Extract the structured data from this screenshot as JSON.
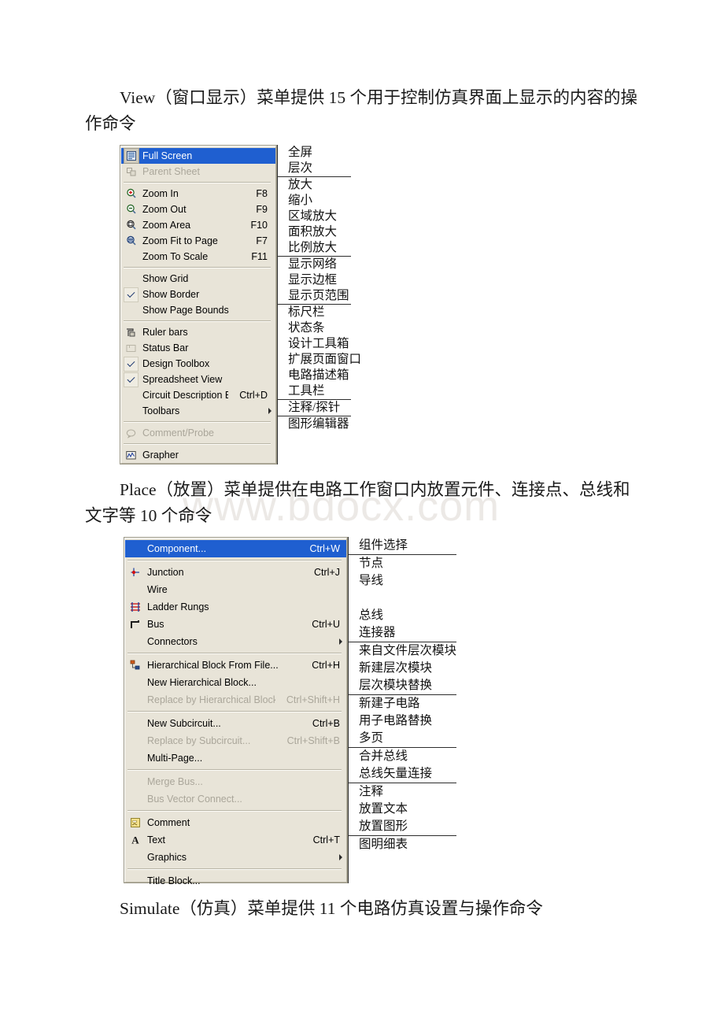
{
  "paragraphs": {
    "view_intro": "View（窗口显示）菜单提供 15 个用于控制仿真界面上显示的内容的操作命令",
    "place_intro": "Place（放置）菜单提供在电路工作窗口内放置元件、连接点、总线和文字等 10 个命令",
    "simulate_intro": "Simulate（仿真）菜单提供 11 个电路仿真设置与操作命令"
  },
  "watermark": "www.bdocx.com",
  "colors": {
    "menu_background": "#e8e4d8",
    "menu_border": "#9a9684",
    "highlight": "#1f5fd0",
    "highlight_text": "#ffffff",
    "disabled_text": "#aaa69a",
    "separator": "#b9b5a6"
  },
  "view_menu": {
    "name": "View",
    "items": [
      {
        "label": "Full Screen",
        "accel": "",
        "icon": "full-screen-icon",
        "state": "selected",
        "checked": false,
        "submenu": false
      },
      {
        "label": "Parent Sheet",
        "accel": "",
        "icon": "parent-sheet-icon",
        "state": "disabled",
        "checked": false,
        "submenu": false
      },
      {
        "separator": true
      },
      {
        "label": "Zoom In",
        "accel": "F8",
        "icon": "zoom-in-icon",
        "state": "normal",
        "checked": false,
        "submenu": false
      },
      {
        "label": "Zoom Out",
        "accel": "F9",
        "icon": "zoom-out-icon",
        "state": "normal",
        "checked": false,
        "submenu": false
      },
      {
        "label": "Zoom Area",
        "accel": "F10",
        "icon": "zoom-area-icon",
        "state": "normal",
        "checked": false,
        "submenu": false
      },
      {
        "label": "Zoom Fit to Page",
        "accel": "F7",
        "icon": "zoom-fit-page-icon",
        "state": "normal",
        "checked": false,
        "submenu": false
      },
      {
        "label": "Zoom To Scale",
        "accel": "F11",
        "icon": "",
        "state": "normal",
        "checked": false,
        "submenu": false
      },
      {
        "separator": true
      },
      {
        "label": "Show Grid",
        "accel": "",
        "icon": "",
        "state": "normal",
        "checked": false,
        "submenu": false
      },
      {
        "label": "Show Border",
        "accel": "",
        "icon": "",
        "state": "normal",
        "checked": true,
        "submenu": false
      },
      {
        "label": "Show Page Bounds",
        "accel": "",
        "icon": "",
        "state": "normal",
        "checked": false,
        "submenu": false
      },
      {
        "separator": true
      },
      {
        "label": "Ruler bars",
        "accel": "",
        "icon": "ruler-bars-icon",
        "state": "normal",
        "checked": false,
        "submenu": false
      },
      {
        "label": "Status Bar",
        "accel": "",
        "icon": "status-bar-icon",
        "state": "normal",
        "checked": false,
        "submenu": false
      },
      {
        "label": "Design Toolbox",
        "accel": "",
        "icon": "",
        "state": "normal",
        "checked": true,
        "submenu": false
      },
      {
        "label": "Spreadsheet View",
        "accel": "",
        "icon": "",
        "state": "normal",
        "checked": true,
        "submenu": false
      },
      {
        "label": "Circuit Description Box",
        "accel": "Ctrl+D",
        "icon": "",
        "state": "normal",
        "checked": false,
        "submenu": false
      },
      {
        "label": "Toolbars",
        "accel": "",
        "icon": "",
        "state": "normal",
        "checked": false,
        "submenu": true
      },
      {
        "separator": true
      },
      {
        "label": "Comment/Probe",
        "accel": "",
        "icon": "comment-probe-icon",
        "state": "disabled",
        "checked": false,
        "submenu": false
      },
      {
        "separator": true
      },
      {
        "label": "Grapher",
        "accel": "",
        "icon": "grapher-icon",
        "state": "normal",
        "checked": false,
        "submenu": false
      }
    ],
    "translations": [
      {
        "rows": [
          "全屏",
          "层次"
        ]
      },
      {
        "rows": [
          "放大",
          "缩小",
          "区域放大",
          "面积放大",
          "比例放大"
        ]
      },
      {
        "rows": [
          "显示网络",
          "显示边框",
          "显示页范围"
        ]
      },
      {
        "rows": [
          "标尺栏",
          "状态条",
          "设计工具箱",
          "扩展页面窗口",
          "电路描述箱",
          "工具栏"
        ]
      },
      {
        "rows": [
          "注释/探针"
        ]
      },
      {
        "rows": [
          "图形编辑器"
        ]
      }
    ]
  },
  "place_menu": {
    "name": "Place",
    "items": [
      {
        "label": "Component...",
        "accel": "Ctrl+W",
        "icon": "",
        "state": "selected",
        "submenu": false
      },
      {
        "separator": true
      },
      {
        "label": "Junction",
        "accel": "Ctrl+J",
        "icon": "junction-icon",
        "state": "normal",
        "submenu": false
      },
      {
        "label": "Wire",
        "accel": "",
        "icon": "",
        "state": "normal",
        "submenu": false
      },
      {
        "label": "Ladder Rungs",
        "accel": "",
        "icon": "ladder-rungs-icon",
        "state": "normal",
        "submenu": false
      },
      {
        "label": "Bus",
        "accel": "Ctrl+U",
        "icon": "bus-icon",
        "state": "normal",
        "submenu": false
      },
      {
        "label": "Connectors",
        "accel": "",
        "icon": "",
        "state": "normal",
        "submenu": true
      },
      {
        "separator": true
      },
      {
        "label": "Hierarchical Block From File...",
        "accel": "Ctrl+H",
        "icon": "hierarchical-block-icon",
        "state": "normal",
        "submenu": false
      },
      {
        "label": "New Hierarchical Block...",
        "accel": "",
        "icon": "",
        "state": "normal",
        "submenu": false
      },
      {
        "label": "Replace by Hierarchical Block...",
        "accel": "Ctrl+Shift+H",
        "icon": "",
        "state": "disabled",
        "submenu": false
      },
      {
        "separator": true
      },
      {
        "label": "New Subcircuit...",
        "accel": "Ctrl+B",
        "icon": "",
        "state": "normal",
        "submenu": false
      },
      {
        "label": "Replace by Subcircuit...",
        "accel": "Ctrl+Shift+B",
        "icon": "",
        "state": "disabled",
        "submenu": false
      },
      {
        "label": "Multi-Page...",
        "accel": "",
        "icon": "",
        "state": "normal",
        "submenu": false
      },
      {
        "separator": true
      },
      {
        "label": "Merge Bus...",
        "accel": "",
        "icon": "",
        "state": "disabled",
        "submenu": false
      },
      {
        "label": "Bus Vector Connect...",
        "accel": "",
        "icon": "",
        "state": "disabled",
        "submenu": false
      },
      {
        "separator": true
      },
      {
        "label": "Comment",
        "accel": "",
        "icon": "comment-icon",
        "state": "normal",
        "submenu": false
      },
      {
        "label": "Text",
        "accel": "Ctrl+T",
        "icon": "text-icon",
        "state": "normal",
        "submenu": false
      },
      {
        "label": "Graphics",
        "accel": "",
        "icon": "",
        "state": "normal",
        "submenu": true
      },
      {
        "separator": true
      },
      {
        "label": "Title Block...",
        "accel": "",
        "icon": "",
        "state": "normal",
        "submenu": false
      }
    ],
    "translations": [
      {
        "rows": [
          "组件选择"
        ]
      },
      {
        "rows": [
          "节点",
          "导线",
          "",
          "总线",
          "连接器"
        ]
      },
      {
        "rows": [
          "来自文件层次模块",
          "新建层次模块",
          "层次模块替换"
        ]
      },
      {
        "rows": [
          "新建子电路",
          "用子电路替换",
          "多页"
        ]
      },
      {
        "rows": [
          "合并总线",
          "总线矢量连接"
        ]
      },
      {
        "rows": [
          "注释",
          "放置文本",
          "放置图形"
        ]
      },
      {
        "rows": [
          "图明细表"
        ]
      }
    ]
  }
}
